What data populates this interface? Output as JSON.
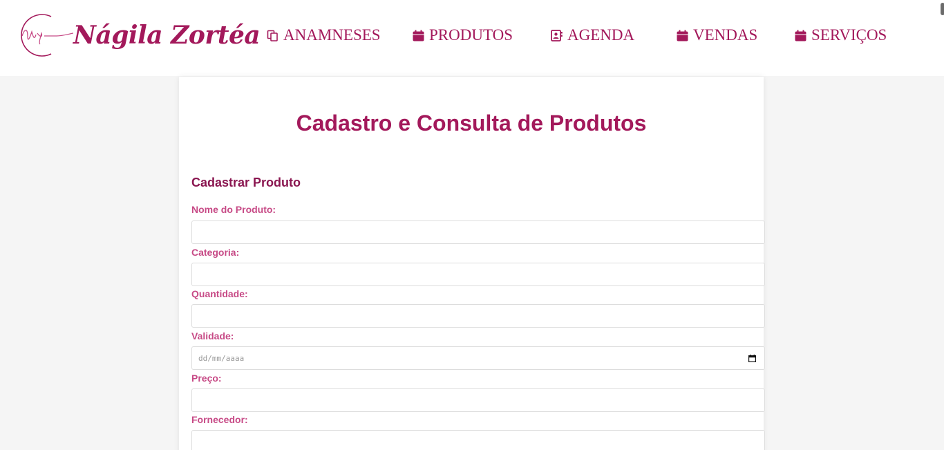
{
  "brand": {
    "name": "Nágila Zortéa",
    "accent": "#a3195b"
  },
  "nav": [
    {
      "label": "ANAMNESES",
      "icon": "copy-icon"
    },
    {
      "label": "PRODUTOS",
      "icon": "calendar-icon"
    },
    {
      "label": "AGENDA",
      "icon": "contact-card-icon"
    },
    {
      "label": "VENDAS",
      "icon": "calendar-icon"
    },
    {
      "label": "SERVIÇOS",
      "icon": "calendar-icon"
    }
  ],
  "main": {
    "title": "Cadastro e Consulta de Produtos",
    "section_title": "Cadastrar Produto",
    "fields": [
      {
        "label": "Nome do Produto:",
        "value": ""
      },
      {
        "label": "Categoria:",
        "value": ""
      },
      {
        "label": "Quantidade:",
        "value": ""
      },
      {
        "label": "Validade:",
        "placeholder": "dd/mm/aaaa"
      },
      {
        "label": "Preço:",
        "value": ""
      },
      {
        "label": "Fornecedor:",
        "value": ""
      }
    ]
  }
}
